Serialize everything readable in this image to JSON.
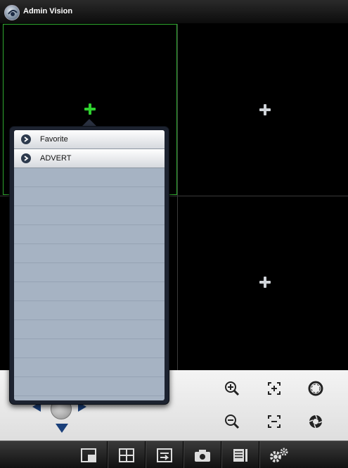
{
  "app": {
    "title": "Admin Vision",
    "logo_icon": "app-logo-icon"
  },
  "video_grid": {
    "cells": [
      {
        "id": "channel-1",
        "selected": true,
        "action_icon": "add-camera-icon",
        "accent": "#2fd02f"
      },
      {
        "id": "channel-2",
        "selected": false,
        "action_icon": "add-camera-icon"
      },
      {
        "id": "channel-3",
        "selected": false,
        "action_icon": "add-camera-icon"
      },
      {
        "id": "channel-4",
        "selected": false,
        "action_icon": "add-camera-icon"
      }
    ],
    "selected_border_color": "#2fa82f"
  },
  "device_popover": {
    "items": [
      {
        "label": "Favorite",
        "icon": "chevron-right-icon"
      },
      {
        "label": "ADVERT",
        "icon": "chevron-right-icon"
      }
    ]
  },
  "ptz": {
    "arrow_color": "#1a3f7a",
    "icons": [
      "ptz-left-icon",
      "ptz-right-icon",
      "ptz-down-icon",
      "ptz-joystick-icon"
    ]
  },
  "controls": {
    "icons": [
      "zoom-in-icon",
      "focus-near-icon",
      "iris-open-icon",
      "zoom-out-icon",
      "focus-far-icon",
      "iris-close-icon"
    ]
  },
  "toolbar": {
    "icons": [
      "single-view-icon",
      "quad-view-icon",
      "playback-icon",
      "snapshot-icon",
      "device-list-icon",
      "settings-icon"
    ]
  }
}
